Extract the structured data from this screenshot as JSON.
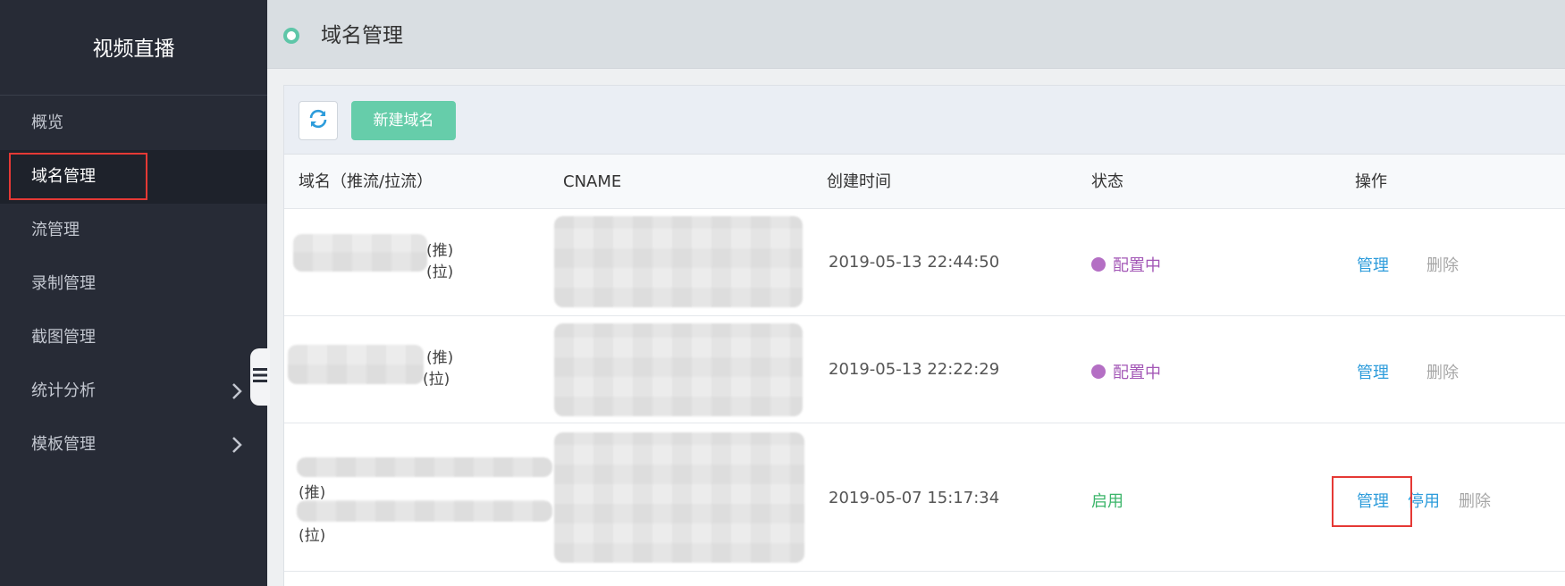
{
  "sidebar": {
    "title": "视频直播",
    "items": [
      {
        "label": "概览"
      },
      {
        "label": "域名管理"
      },
      {
        "label": "流管理"
      },
      {
        "label": "录制管理"
      },
      {
        "label": "截图管理"
      },
      {
        "label": "统计分析"
      },
      {
        "label": "模板管理"
      }
    ]
  },
  "header": {
    "title": "域名管理"
  },
  "toolbar": {
    "new_domain_label": "新建域名",
    "refresh_icon": "refresh-icon"
  },
  "table": {
    "columns": [
      "域名（推流/拉流）",
      "CNAME",
      "创建时间",
      "状态",
      "操作"
    ],
    "rows": [
      {
        "push": "(推)",
        "pull": "(拉)",
        "time": "2019-05-13 22:44:50",
        "status": "配置中",
        "actions": [
          "管理",
          "删除"
        ]
      },
      {
        "push": "(推)",
        "pull": "(拉)",
        "time": "2019-05-13 22:22:29",
        "status": "配置中",
        "actions": [
          "管理",
          "删除"
        ]
      },
      {
        "push": "(推)",
        "pull": "(拉)",
        "time": "2019-05-07 15:17:34",
        "status": "启用",
        "actions": [
          "管理",
          "停用",
          "删除"
        ]
      }
    ]
  },
  "colors": {
    "sidebar_bg": "#272b36",
    "accent_green": "#66cdaa",
    "status_config": "#a357b6",
    "status_enabled": "#3bb56a",
    "link_blue": "#2d9cdb",
    "highlight_red": "#e53935"
  }
}
